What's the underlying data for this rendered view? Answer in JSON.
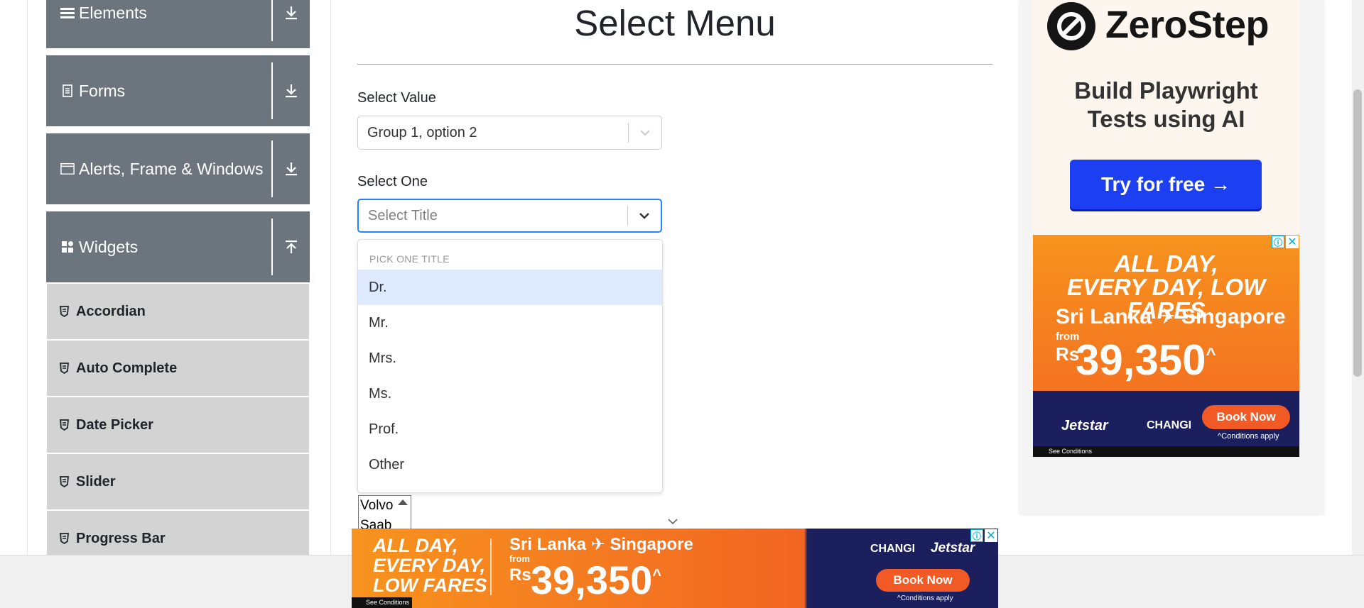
{
  "sidebar": {
    "groups": [
      {
        "title": "Elements",
        "icon": "hamburger-icon",
        "toggle": "download-icon"
      },
      {
        "title": "Forms",
        "icon": "document-icon",
        "toggle": "download-icon"
      },
      {
        "title": "Alerts, Frame & Windows",
        "icon": "window-icon",
        "toggle": "download-icon"
      },
      {
        "title": "Widgets",
        "icon": "grid-icon",
        "toggle": "upload-icon"
      }
    ],
    "items": [
      {
        "label": "Accordian"
      },
      {
        "label": "Auto Complete"
      },
      {
        "label": "Date Picker"
      },
      {
        "label": "Slider"
      },
      {
        "label": "Progress Bar"
      }
    ]
  },
  "main": {
    "title": "Select Menu",
    "select_value": {
      "label": "Select Value",
      "value": "Group 1, option 2"
    },
    "select_one": {
      "label": "Select One",
      "placeholder": "Select Title"
    },
    "dropdown": {
      "group_label": "PICK ONE TITLE",
      "options": [
        "Dr.",
        "Mr.",
        "Mrs.",
        "Ms.",
        "Prof.",
        "Other"
      ],
      "highlighted": "Dr."
    },
    "multi_list": [
      "Volvo",
      "Saab"
    ]
  },
  "ads": {
    "zerostep": {
      "name": "ZeroStep",
      "tagline_line1": "Build Playwright",
      "tagline_line2": "Tests using AI",
      "cta": "Try for free →"
    },
    "jetstar_side": {
      "head_line1": "ALL DAY,",
      "head_line2": "EVERY DAY, LOW FARES",
      "route": "Sri Lanka ✈ Singapore",
      "from": "from",
      "currency": "Rs",
      "price": "39,350",
      "price_mark": "^",
      "brand1": "Jetstar",
      "brand2": "CHANGI",
      "cta": "Book Now",
      "conditions": "^Conditions apply",
      "see_conditions": "See Conditions"
    },
    "jetstar_bottom": {
      "head_line1": "ALL DAY,",
      "head_line2": "EVERY DAY,",
      "head_line3": "LOW FARES",
      "route": "Sri Lanka ✈ Singapore",
      "from": "from",
      "currency": "Rs",
      "price": "39,350",
      "price_mark": "^",
      "brand1": "CHANGI",
      "brand2": "Jetstar",
      "cta": "Book Now",
      "conditions": "^Conditions apply",
      "see_conditions": "See Conditions"
    },
    "info_glyph": "ⓘ",
    "close_glyph": "✕"
  },
  "colors": {
    "sidebar_header": "#6c757d",
    "sidebar_item": "#d3d3d3",
    "focus_border": "#2684ff",
    "option_highlight": "#deebff",
    "zerostep_button": "#1c3ff2",
    "jetstar_orange": "#f26522",
    "jetstar_navy": "#1b1f5e"
  }
}
